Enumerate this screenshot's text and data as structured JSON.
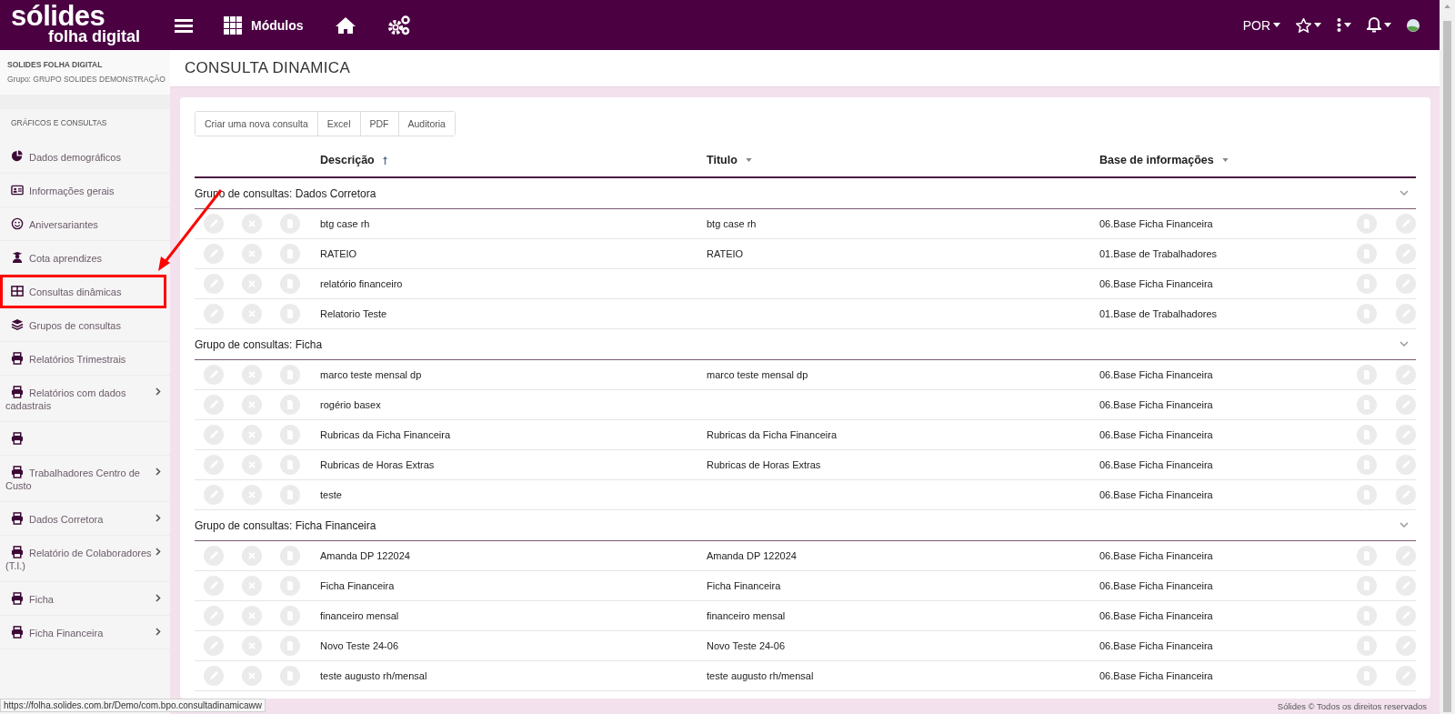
{
  "topbar": {
    "logo_main": "sólides",
    "logo_sub": "folha digital",
    "modules_label": "Módulos",
    "language": "POR"
  },
  "sidebar": {
    "company": "SOLIDES FOLHA DIGITAL",
    "group": "Grupo: GRUPO SOLIDES DEMONSTRAÇÃO",
    "section": "GRÁFICOS E CONSULTAS",
    "items": [
      {
        "label": "Dados demográficos",
        "expandable": false,
        "highlighted": false
      },
      {
        "label": "Informações gerais",
        "expandable": false,
        "highlighted": false
      },
      {
        "label": "Aniversariantes",
        "expandable": false,
        "highlighted": false
      },
      {
        "label": "Cota aprendizes",
        "expandable": false,
        "highlighted": false
      },
      {
        "label": "Consultas dinâmicas",
        "expandable": false,
        "highlighted": true
      },
      {
        "label": "Grupos de consultas",
        "expandable": false,
        "highlighted": false
      },
      {
        "label": "Relatórios Trimestrais",
        "expandable": false,
        "highlighted": false
      },
      {
        "label": "Relatórios com dados cadastrais",
        "expandable": true,
        "highlighted": false
      },
      {
        "expandable": false,
        "highlighted": false
      },
      {
        "label": "Trabalhadores Centro de Custo",
        "expandable": true,
        "highlighted": false
      },
      {
        "label": "Dados Corretora",
        "expandable": true,
        "highlighted": false
      },
      {
        "label": "Relatório de Colaboradores (T.I.)",
        "expandable": true,
        "highlighted": false
      },
      {
        "label": "Ficha",
        "expandable": true,
        "highlighted": false
      },
      {
        "label": "Ficha Financeira",
        "expandable": true,
        "highlighted": false
      }
    ]
  },
  "page_title": "CONSULTA DINAMICA",
  "toolbar": [
    "Criar uma nova consulta",
    "Excel",
    "PDF",
    "Auditoria"
  ],
  "table": {
    "columns": [
      {
        "label": "Descrição",
        "sorted": true
      },
      {
        "label": "Titulo",
        "sorted": false
      },
      {
        "label": "Base de informações",
        "sorted": false
      }
    ],
    "groups": [
      {
        "label": "Grupo de consultas: Dados Corretora",
        "expanded": true,
        "rows": [
          [
            "btg case rh",
            "btg case rh",
            "06.Base Ficha Financeira"
          ],
          [
            "RATEIO",
            "RATEIO",
            "01.Base de Trabalhadores"
          ],
          [
            "relatório financeiro",
            "",
            "06.Base Ficha Financeira"
          ],
          [
            "Relatorio Teste",
            "",
            "01.Base de Trabalhadores"
          ]
        ]
      },
      {
        "label": "Grupo de consultas: Ficha",
        "expanded": true,
        "rows": [
          [
            "marco teste mensal dp",
            "marco teste mensal dp",
            "06.Base Ficha Financeira"
          ],
          [
            "rogério basex",
            "",
            "06.Base Ficha Financeira"
          ],
          [
            "Rubricas da Ficha Financeira",
            "Rubricas da Ficha Financeira",
            "06.Base Ficha Financeira"
          ],
          [
            "Rubricas de Horas Extras",
            "Rubricas de Horas Extras",
            "06.Base Ficha Financeira"
          ],
          [
            "teste",
            "",
            "06.Base Ficha Financeira"
          ]
        ]
      },
      {
        "label": "Grupo de consultas: Ficha Financeira",
        "expanded": true,
        "rows": [
          [
            "Amanda DP 122024",
            "Amanda DP 122024",
            "06.Base Ficha Financeira"
          ],
          [
            "Ficha Financeira",
            "Ficha Financeira",
            "06.Base Ficha Financeira"
          ],
          [
            "financeiro mensal",
            "financeiro mensal",
            "06.Base Ficha Financeira"
          ],
          [
            "Novo Teste 24-06",
            "Novo Teste 24-06",
            "06.Base Ficha Financeira"
          ],
          [
            "teste augusto rh/mensal",
            "teste augusto rh/mensal",
            "06.Base Ficha Financeira"
          ]
        ]
      }
    ]
  },
  "status_url": "https://folha.solides.com.br/Demo/com.bpo.consultadinamicaww",
  "footer": "Sólides © Todos os direitos reservados"
}
